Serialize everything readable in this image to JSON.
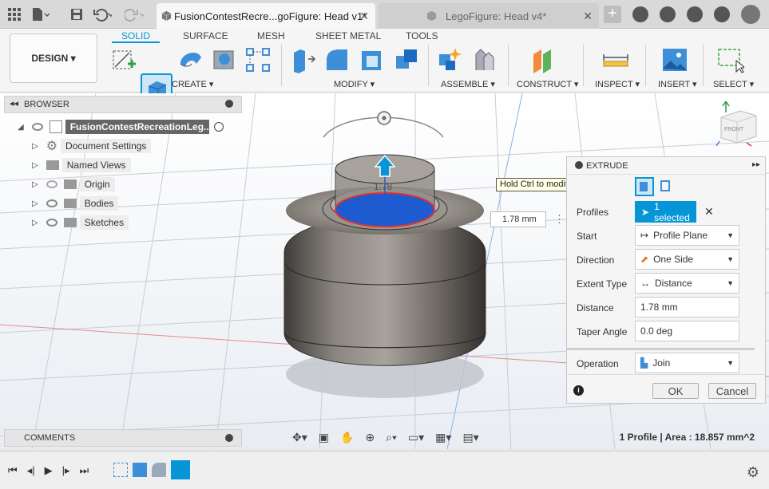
{
  "titlebar": {
    "active_tab": "FusionContestRecre...goFigure: Head v1*",
    "inactive_tab": "LegoFigure: Head v4*",
    "new_tab": "+"
  },
  "toolbar": {
    "workspace_button": "DESIGN",
    "tabs": [
      "SOLID",
      "SURFACE",
      "MESH",
      "SHEET METAL",
      "TOOLS"
    ],
    "groups": [
      "CREATE",
      "MODIFY",
      "ASSEMBLE",
      "CONSTRUCT",
      "INSPECT",
      "INSERT",
      "SELECT"
    ]
  },
  "browser": {
    "title": "BROWSER",
    "root": "FusionContestRecreationLeg...",
    "items": [
      "Document Settings",
      "Named Views",
      "Origin",
      "Bodies",
      "Sketches"
    ]
  },
  "comments": {
    "title": "COMMENTS"
  },
  "viewport": {
    "tooltip": "Hold Ctrl to modify selection",
    "distance_input": "1.78 mm",
    "dim_label": "1.78",
    "viewcube_label": "FRONT",
    "status": "1 Profile | Area : 18.857 mm^2"
  },
  "extrude": {
    "title": "EXTRUDE",
    "profiles_label": "Profiles",
    "profiles_value": "1 selected",
    "start_label": "Start",
    "start_value": "Profile Plane",
    "direction_label": "Direction",
    "direction_value": "One Side",
    "extent_label": "Extent Type",
    "extent_value": "Distance",
    "distance_label": "Distance",
    "distance_value": "1.78 mm",
    "taper_label": "Taper Angle",
    "taper_value": "0.0 deg",
    "operation_label": "Operation",
    "operation_value": "Join",
    "ok": "OK",
    "cancel": "Cancel"
  },
  "colors": {
    "accent": "#0696d7",
    "body": "#8a8580",
    "profile_blue": "#1e5bd0",
    "selection_red": "#e03030"
  }
}
